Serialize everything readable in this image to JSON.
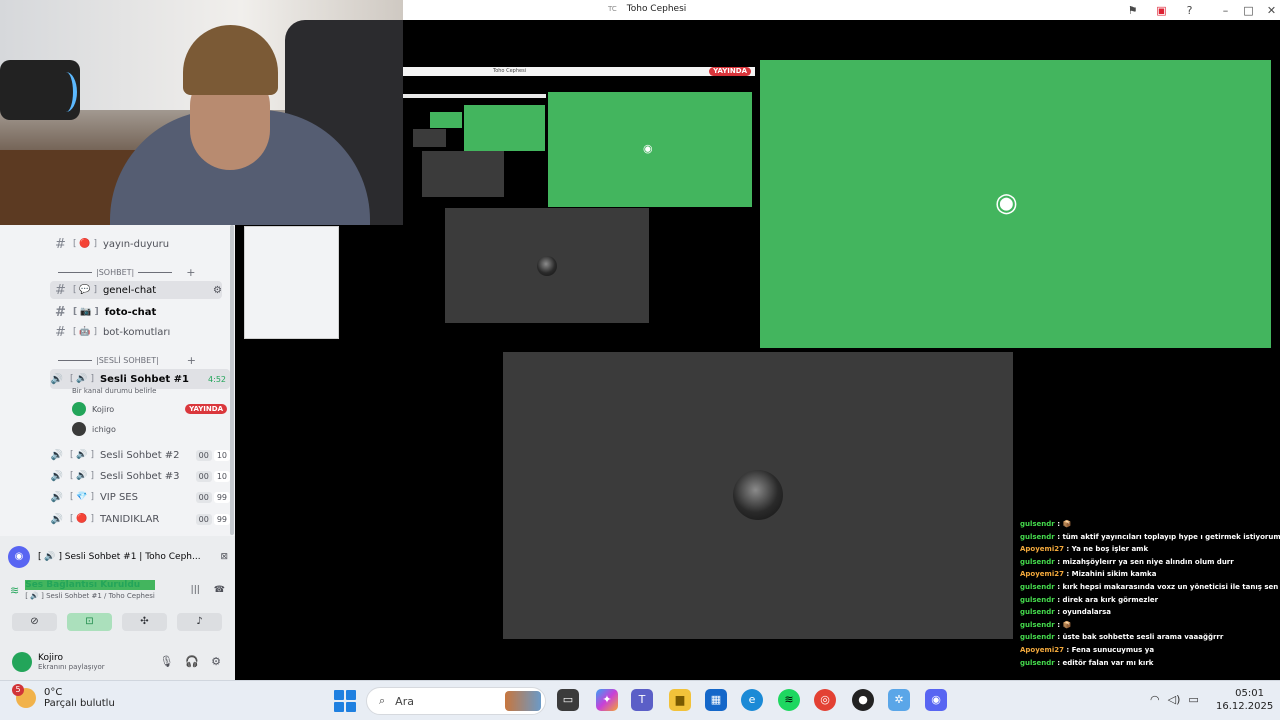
{
  "window": {
    "title_prefix": "TC",
    "title": "Toho Cephesi"
  },
  "sidebar": {
    "channels_top": [
      {
        "bracket": "[ 🔴 ]",
        "name": "yayın-duyuru"
      }
    ],
    "category_chat": "|SOHBET|",
    "text_channels": [
      {
        "bracket": "[ 💬 ]",
        "name": "genel-chat"
      },
      {
        "bracket": "[ 📷 ]",
        "name": "foto-chat"
      },
      {
        "bracket": "[ 🤖 ]",
        "name": "bot-komutları"
      }
    ],
    "category_voice": "|SESLİ SOHBET|",
    "active_voice": {
      "bracket": "[ 🔊 ]",
      "name": "Sesli Sohbet #1",
      "time": "4:52",
      "status": "Bir kanal durumu belirle"
    },
    "members": [
      {
        "name": "Kojiro",
        "badge": "YAYINDA"
      },
      {
        "name": "ichigo"
      }
    ],
    "voice_channels": [
      {
        "bracket": "[ 🔊 ]",
        "name": "Sesli Sohbet #2",
        "count": "00",
        "limit": "10"
      },
      {
        "bracket": "[ 🔊 ]",
        "name": "Sesli Sohbet #3",
        "count": "00",
        "limit": "10"
      },
      {
        "bracket": "[ 💎 ]",
        "name": "VIP SES",
        "count": "00",
        "limit": "99"
      },
      {
        "bracket": "[ 🔴 ]",
        "name": "TANIDIKLAR",
        "count": "00",
        "limit": "99"
      }
    ]
  },
  "voice_panel": {
    "header": "[ 🔊 ] Sesli Sohbet #1 | Toho Ceph...",
    "connected": "Ses Bağlantısı Kuruldu",
    "connected_sub": "[ 🔊 ] Sesli Sohbet #1 / Toho Cephesi",
    "user": "Kojiro",
    "user_status": "Ekranını paylaşıyor"
  },
  "stream": {
    "live_badge": "YAYINDA",
    "thin_title": "Toho Cephesi"
  },
  "chat": [
    {
      "user": "gulsendr",
      "msg": "📦"
    },
    {
      "user": "gulsendr",
      "msg": "tüm aktif yayıncıları toplayıp hype ı getirmek istiyorum 😁 😁"
    },
    {
      "user": "Apoyemi27",
      "msg": "Ya ne boş işler amk",
      "alt": true
    },
    {
      "user": "gulsendr",
      "msg": "mizahşöyleırr ya sen niye alındın olum durr"
    },
    {
      "user": "Apoyemi27",
      "msg": "Mizahini sikim kamka",
      "alt": true
    },
    {
      "user": "gulsendr",
      "msg": "kırk hepsi makarasında voxz un yöneticisi ile tanış sen Çağlar"
    },
    {
      "user": "gulsendr",
      "msg": "direk ara kırk görmezler"
    },
    {
      "user": "gulsendr",
      "msg": "oyundalarsa"
    },
    {
      "user": "gulsendr",
      "msg": "📦"
    },
    {
      "user": "gulsendr",
      "msg": "üste bak sohbette sesli arama vaaağğrrr"
    },
    {
      "user": "Apoyemi27",
      "msg": "Fena sunucuymus ya",
      "alt": true
    },
    {
      "user": "gulsendr",
      "msg": "editör falan var mı kırk"
    }
  ],
  "taskbar": {
    "weather_badge": "5",
    "temp": "0°C",
    "condition": "Parçalı bulutlu",
    "search_placeholder": "Ara",
    "time": "05:01",
    "date": "16.12.2025"
  }
}
